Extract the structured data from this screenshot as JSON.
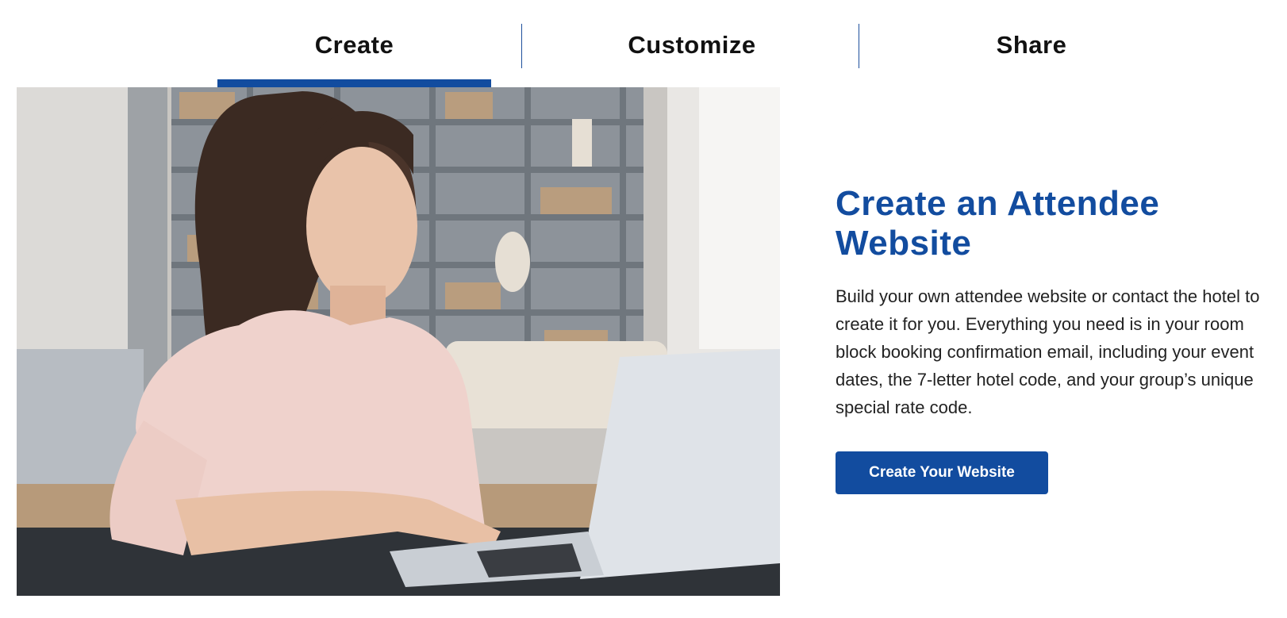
{
  "tabs": [
    {
      "label": "Create",
      "active": true
    },
    {
      "label": "Customize",
      "active": false
    },
    {
      "label": "Share",
      "active": false
    }
  ],
  "hero": {
    "image_alt": "woman smiling while typing on a laptop",
    "headline": "Create an Attendee Website",
    "body": "Build your own attendee website or contact the hotel to create it for you. Everything you need is in your room block booking confirmation email, including your event dates, the 7-letter hotel code, and your group’s unique special rate code.",
    "cta_label": "Create Your Website"
  },
  "colors": {
    "brand_blue": "#124c9f",
    "text_dark": "#222222"
  }
}
